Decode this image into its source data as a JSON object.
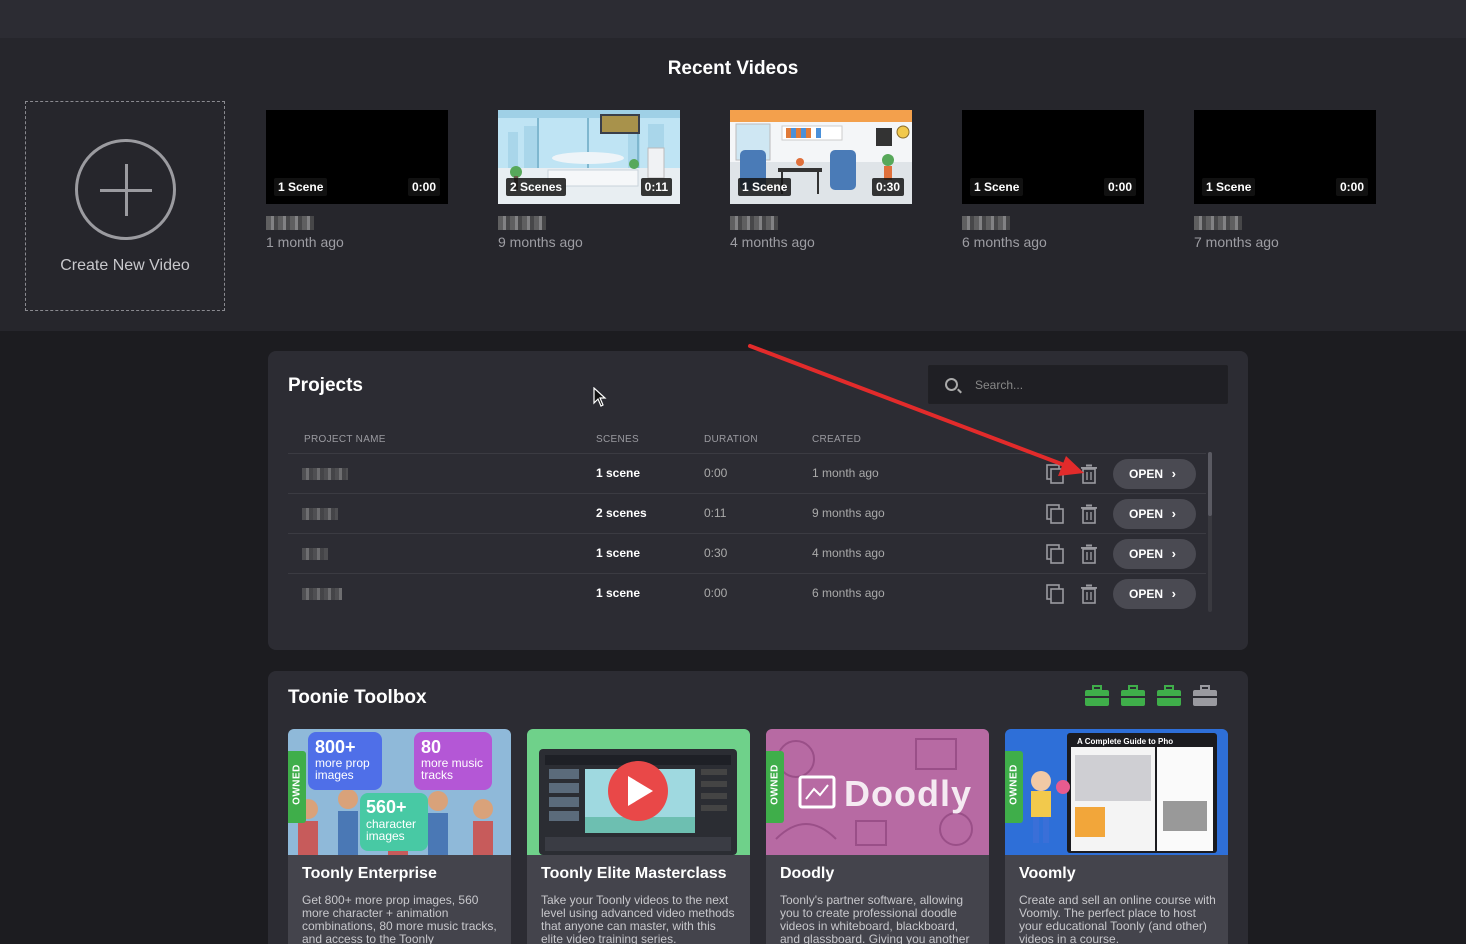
{
  "recent": {
    "title": "Recent Videos",
    "create_label": "Create New Video",
    "videos": [
      {
        "scenes": "1 Scene",
        "duration": "0:00",
        "age": "1 month ago",
        "thumb": "black"
      },
      {
        "scenes": "2 Scenes",
        "duration": "0:11",
        "age": "9 months ago",
        "thumb": "airport"
      },
      {
        "scenes": "1 Scene",
        "duration": "0:30",
        "age": "4 months ago",
        "thumb": "office"
      },
      {
        "scenes": "1 Scene",
        "duration": "0:00",
        "age": "6 months ago",
        "thumb": "black"
      },
      {
        "scenes": "1 Scene",
        "duration": "0:00",
        "age": "7 months ago",
        "thumb": "black"
      }
    ]
  },
  "projects": {
    "title": "Projects",
    "search_placeholder": "Search...",
    "columns": {
      "name": "PROJECT NAME",
      "scenes": "SCENES",
      "duration": "DURATION",
      "created": "CREATED"
    },
    "open_label": "OPEN",
    "rows": [
      {
        "scenes": "1 scene",
        "duration": "0:00",
        "created": "1 month ago"
      },
      {
        "scenes": "2 scenes",
        "duration": "0:11",
        "created": "9 months ago"
      },
      {
        "scenes": "1 scene",
        "duration": "0:30",
        "created": "4 months ago"
      },
      {
        "scenes": "1 scene",
        "duration": "0:00",
        "created": "6 months ago"
      }
    ]
  },
  "toolbox": {
    "title": "Toonie Toolbox",
    "owned_label": "OWNED",
    "icon_colors": [
      "#3fae4a",
      "#3fae4a",
      "#3fae4a",
      "#9a9aa0"
    ],
    "cards": [
      {
        "title": "Toonly Enterprise",
        "desc": "Get 800+ more prop images, 560 more character + animation combinations, 80 more music tracks, and access to the Toonly",
        "owned": true,
        "img_texts": {
          "a_big": "800+",
          "a_small": "more prop images",
          "b_big": "80",
          "b_small": "more music tracks",
          "c_big": "560+",
          "c_small": "character images"
        }
      },
      {
        "title": "Toonly Elite Masterclass",
        "desc": "Take your Toonly videos to the next level using advanced video methods that anyone can master, with this elite video training series.",
        "owned": false
      },
      {
        "title": "Doodly",
        "desc": "Toonly's partner software, allowing you to create professional doodle videos in whiteboard, blackboard, and glassboard. Giving you another",
        "owned": true,
        "img_texts": {
          "logo": "Doodly"
        }
      },
      {
        "title": "Voomly",
        "desc": "Create and sell an online course with Voomly. The perfect place to host your educational Toonly (and other) videos in a course.",
        "owned": true,
        "img_texts": {
          "headline": "A Complete Guide to Pho"
        }
      }
    ]
  }
}
